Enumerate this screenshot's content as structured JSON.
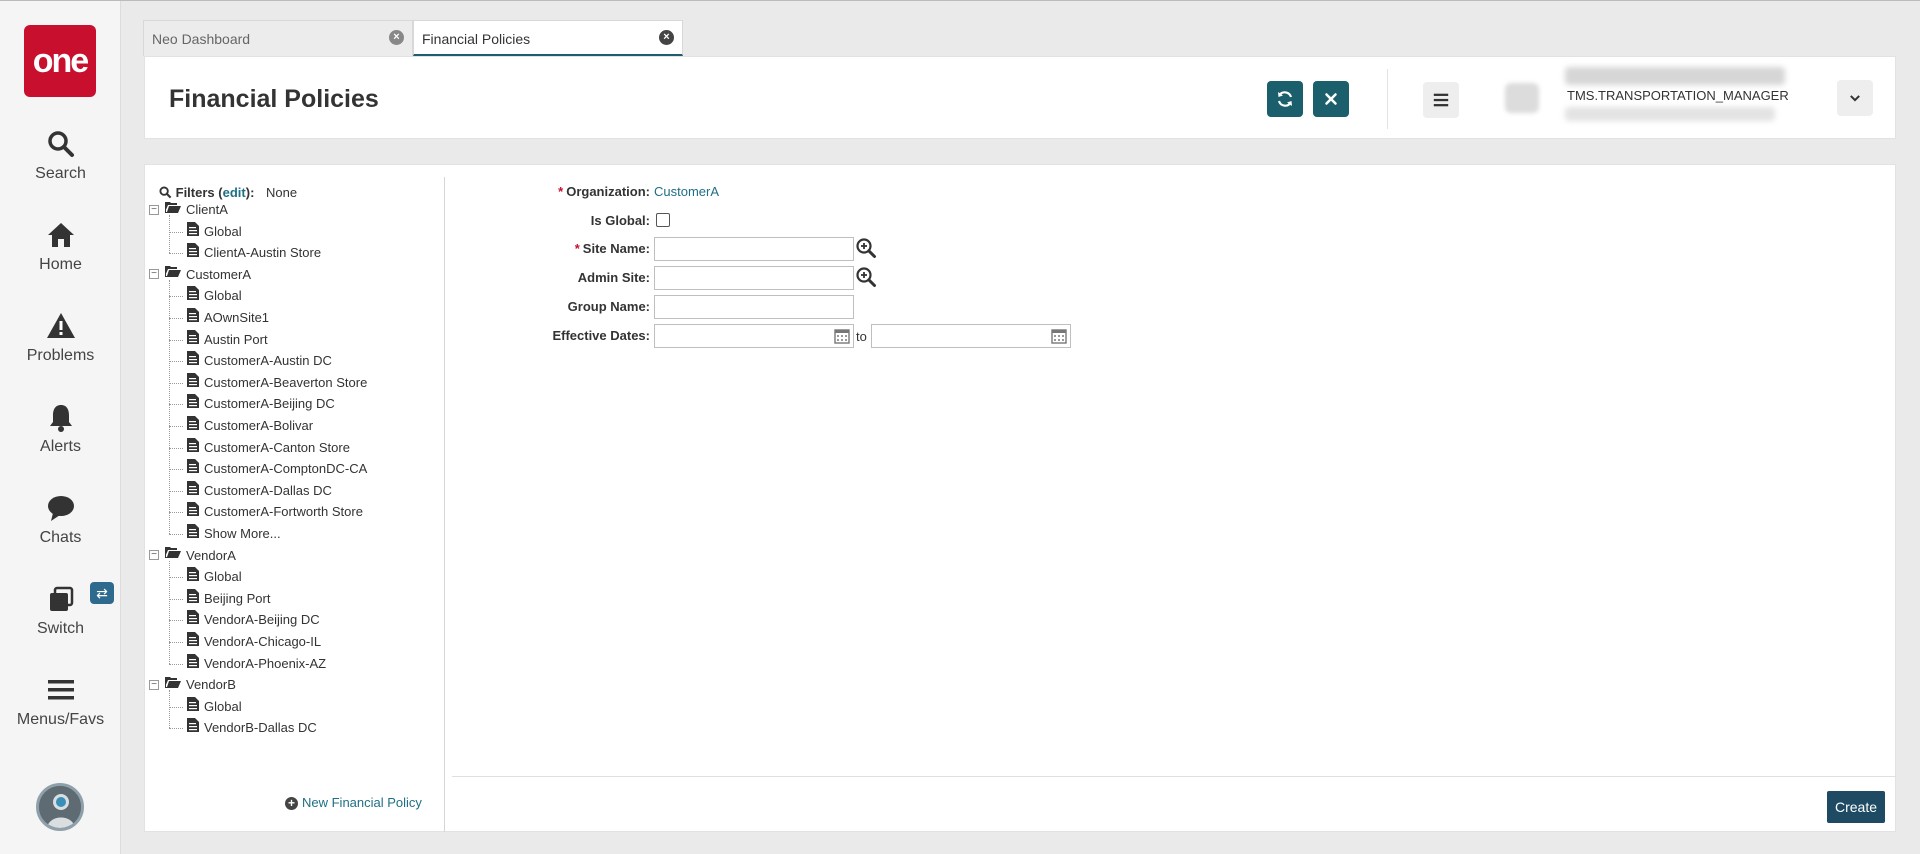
{
  "leftnav": {
    "logo_text": "one",
    "items": [
      {
        "label": "Search",
        "icon": "search-icon"
      },
      {
        "label": "Home",
        "icon": "home-icon"
      },
      {
        "label": "Problems",
        "icon": "warning-icon"
      },
      {
        "label": "Alerts",
        "icon": "bell-icon"
      },
      {
        "label": "Chats",
        "icon": "chat-bubble-icon"
      },
      {
        "label": "Switch",
        "icon": "switch-icon"
      },
      {
        "label": "Menus/Favs",
        "icon": "hamburger-icon"
      }
    ],
    "switch_badge": "⇄"
  },
  "tabs": [
    {
      "label": "Neo Dashboard",
      "active": false
    },
    {
      "label": "Financial Policies",
      "active": true
    }
  ],
  "header": {
    "title": "Financial Policies",
    "user_role": "TMS.TRANSPORTATION_MANAGER",
    "accent_color": "#1a5f6b"
  },
  "tree": {
    "filters_label": "Filters",
    "filters_edit": "edit",
    "filters_value": "None",
    "groups": [
      {
        "name": "ClientA",
        "items": [
          "Global",
          "ClientA-Austin Store"
        ]
      },
      {
        "name": "CustomerA",
        "items": [
          "Global",
          "AOwnSite1",
          "Austin Port",
          "CustomerA-Austin DC",
          "CustomerA-Beaverton Store",
          "CustomerA-Beijing DC",
          "CustomerA-Bolivar",
          "CustomerA-Canton Store",
          "CustomerA-ComptonDC-CA",
          "CustomerA-Dallas DC",
          "CustomerA-Fortworth Store",
          "Show More..."
        ]
      },
      {
        "name": "VendorA",
        "items": [
          "Global",
          "Beijing Port",
          "VendorA-Beijing DC",
          "VendorA-Chicago-IL",
          "VendorA-Phoenix-AZ"
        ]
      },
      {
        "name": "VendorB",
        "items": [
          "Global",
          "VendorB-Dallas DC"
        ]
      }
    ],
    "new_policy_label": "New Financial Policy"
  },
  "form": {
    "organization_label": "Organization:",
    "organization_value": "CustomerA",
    "is_global_label": "Is Global:",
    "site_name_label": "Site Name:",
    "site_name_value": "",
    "admin_site_label": "Admin Site:",
    "admin_site_value": "",
    "group_name_label": "Group Name:",
    "group_name_value": "",
    "effective_dates_label": "Effective Dates:",
    "effective_from": "",
    "effective_to": "",
    "to_label": "to",
    "required_marker": "*"
  },
  "footer": {
    "create_label": "Create"
  }
}
